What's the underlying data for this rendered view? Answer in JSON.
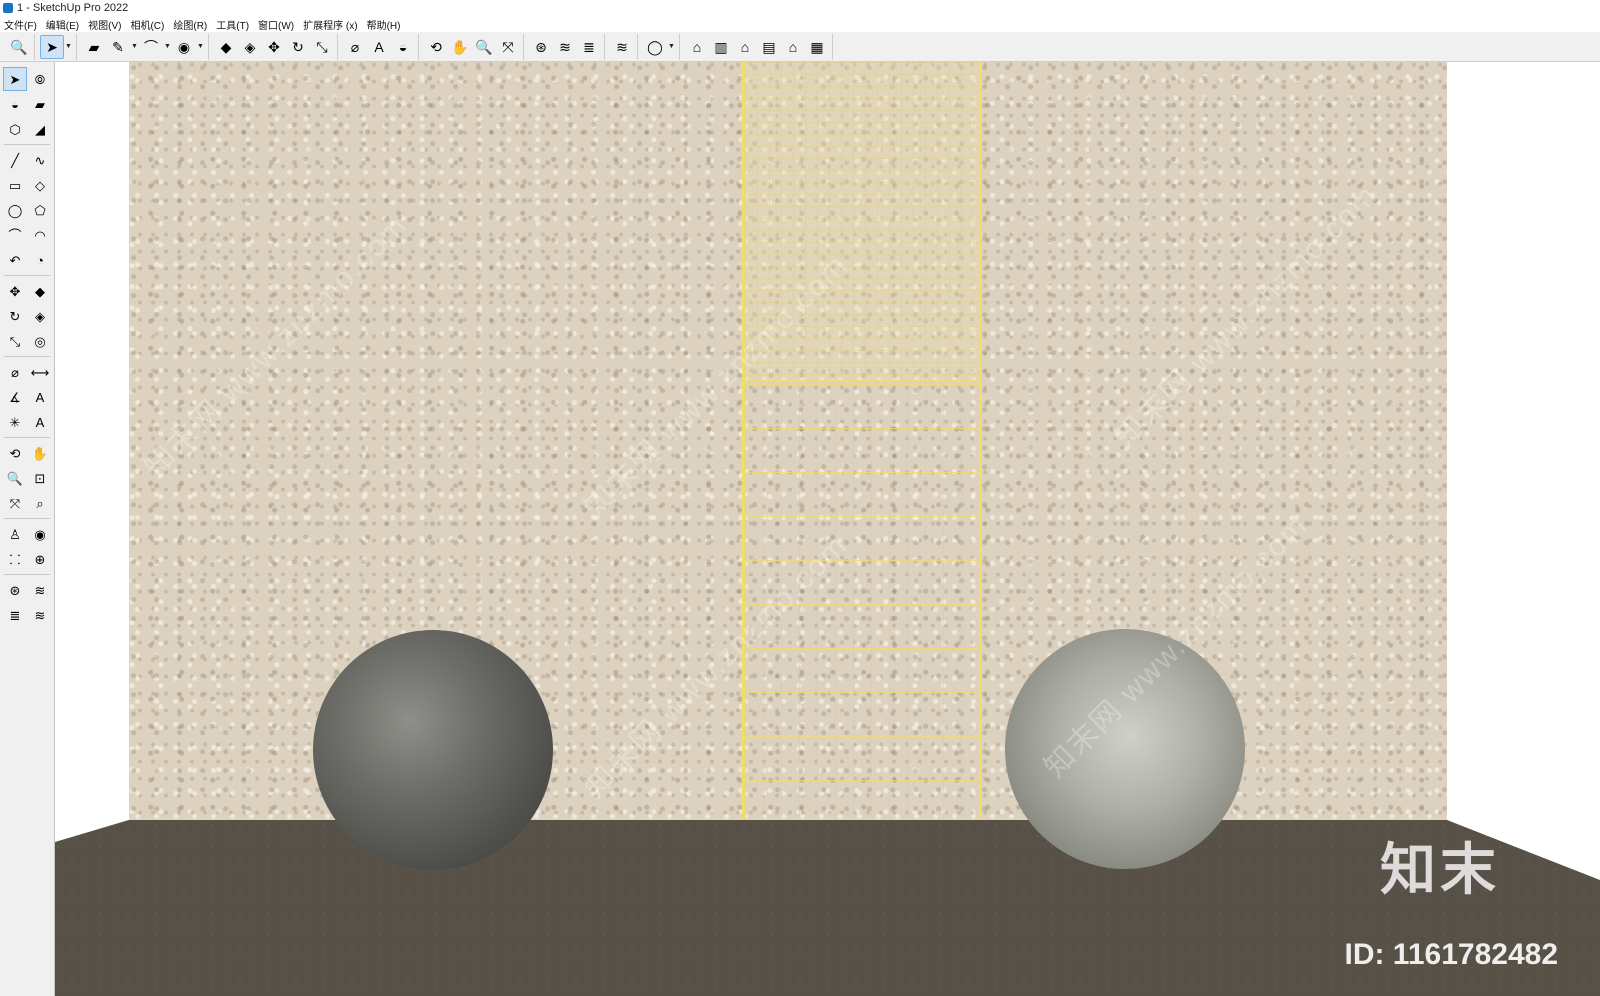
{
  "window": {
    "title": "1 - SketchUp Pro 2022"
  },
  "menu": [
    "文件(F)",
    "编辑(E)",
    "视图(V)",
    "相机(C)",
    "绘图(R)",
    "工具(T)",
    "窗口(W)",
    "扩展程序 (x)",
    "帮助(H)"
  ],
  "toolbar": {
    "groups": [
      [
        {
          "icon": "search-icon",
          "glyph": "🔍"
        }
      ],
      [
        {
          "icon": "select-icon",
          "glyph": "➤",
          "active": true,
          "drop": true
        }
      ],
      [
        {
          "icon": "eraser-icon",
          "glyph": "▰"
        },
        {
          "icon": "pencil-icon",
          "glyph": "✎",
          "drop": true
        },
        {
          "icon": "arc-icon",
          "glyph": "⌒",
          "drop": true
        },
        {
          "icon": "circle-icon",
          "glyph": "◉",
          "drop": true
        }
      ],
      [
        {
          "icon": "push-pull-icon",
          "glyph": "◆"
        },
        {
          "icon": "follow-me-icon",
          "glyph": "◈"
        },
        {
          "icon": "move-icon",
          "glyph": "✥"
        },
        {
          "icon": "rotate-icon",
          "glyph": "↻"
        },
        {
          "icon": "scale-icon",
          "glyph": "⤡"
        }
      ],
      [
        {
          "icon": "tape-measure-icon",
          "glyph": "⌀"
        },
        {
          "icon": "text-icon",
          "glyph": "A"
        },
        {
          "icon": "paint-bucket-icon",
          "glyph": "◒"
        }
      ],
      [
        {
          "icon": "orbit-icon",
          "glyph": "⟲"
        },
        {
          "icon": "pan-icon",
          "glyph": "✋"
        },
        {
          "icon": "zoom-icon",
          "glyph": "🔍"
        },
        {
          "icon": "zoom-extents-icon",
          "glyph": "⤧"
        }
      ],
      [
        {
          "icon": "warehouse-icon",
          "glyph": "⊛"
        },
        {
          "icon": "extension-warehouse-icon",
          "glyph": "≋"
        },
        {
          "icon": "layers-icon",
          "glyph": "≣"
        }
      ],
      [
        {
          "icon": "sandbox-icon",
          "glyph": "≋"
        }
      ],
      [
        {
          "icon": "account-icon",
          "glyph": "◯",
          "drop": true
        }
      ],
      [
        {
          "icon": "iso-view-icon",
          "glyph": "⌂"
        },
        {
          "icon": "top-view-icon",
          "glyph": "▥"
        },
        {
          "icon": "front-view-icon",
          "glyph": "⌂"
        },
        {
          "icon": "right-view-icon",
          "glyph": "▤"
        },
        {
          "icon": "back-view-icon",
          "glyph": "⌂"
        },
        {
          "icon": "left-view-icon",
          "glyph": "▦"
        }
      ]
    ]
  },
  "left_toolbar": [
    [
      {
        "icon": "select-icon",
        "glyph": "➤",
        "active": true
      },
      {
        "icon": "lasso-icon",
        "glyph": "⦾"
      }
    ],
    [
      {
        "icon": "paint-bucket-icon",
        "glyph": "◒"
      },
      {
        "icon": "eraser-icon",
        "glyph": "▰"
      }
    ],
    [
      {
        "icon": "component-icon",
        "glyph": "⬡"
      },
      {
        "icon": "tag-icon",
        "glyph": "◢"
      }
    ],
    [
      {
        "icon": "pencil-icon",
        "glyph": "╱"
      },
      {
        "icon": "freehand-icon",
        "glyph": "∿"
      }
    ],
    [
      {
        "icon": "rectangle-icon",
        "glyph": "▭"
      },
      {
        "icon": "rotated-rect-icon",
        "glyph": "◇"
      }
    ],
    [
      {
        "icon": "circle-icon",
        "glyph": "◯"
      },
      {
        "icon": "polygon-icon",
        "glyph": "⬠"
      }
    ],
    [
      {
        "icon": "arc-icon",
        "glyph": "⌒"
      },
      {
        "icon": "two-point-arc-icon",
        "glyph": "◠"
      }
    ],
    [
      {
        "icon": "three-point-arc-icon",
        "glyph": "↶"
      },
      {
        "icon": "pie-icon",
        "glyph": "◔"
      }
    ],
    [
      {
        "icon": "move-icon",
        "glyph": "✥"
      },
      {
        "icon": "push-pull-icon",
        "glyph": "◆"
      }
    ],
    [
      {
        "icon": "rotate-icon",
        "glyph": "↻"
      },
      {
        "icon": "follow-me-icon",
        "glyph": "◈"
      }
    ],
    [
      {
        "icon": "scale-icon",
        "glyph": "⤡"
      },
      {
        "icon": "offset-icon",
        "glyph": "◎"
      }
    ],
    [
      {
        "icon": "tape-measure-icon",
        "glyph": "⌀"
      },
      {
        "icon": "dimension-icon",
        "glyph": "⟷"
      }
    ],
    [
      {
        "icon": "protractor-icon",
        "glyph": "∡"
      },
      {
        "icon": "text-icon",
        "glyph": "A"
      }
    ],
    [
      {
        "icon": "axes-icon",
        "glyph": "✳"
      },
      {
        "icon": "3d-text-icon",
        "glyph": "A"
      }
    ],
    [
      {
        "icon": "orbit-icon",
        "glyph": "⟲"
      },
      {
        "icon": "pan-icon",
        "glyph": "✋"
      }
    ],
    [
      {
        "icon": "zoom-icon",
        "glyph": "🔍"
      },
      {
        "icon": "zoom-window-icon",
        "glyph": "⊡"
      }
    ],
    [
      {
        "icon": "zoom-extents-icon",
        "glyph": "⤧"
      },
      {
        "icon": "previous-view-icon",
        "glyph": "⌕"
      }
    ],
    [
      {
        "icon": "position-camera-icon",
        "glyph": "♙"
      },
      {
        "icon": "look-around-icon",
        "glyph": "◉"
      }
    ],
    [
      {
        "icon": "walk-icon",
        "glyph": "⸬"
      },
      {
        "icon": "section-plane-icon",
        "glyph": "⊕"
      }
    ],
    [
      {
        "icon": "warehouse-icon",
        "glyph": "⊛"
      },
      {
        "icon": "extension-warehouse-icon",
        "glyph": "≋"
      }
    ],
    [
      {
        "icon": "layers-icon",
        "glyph": "≣"
      },
      {
        "icon": "sandbox-icon",
        "glyph": "≋"
      }
    ]
  ],
  "viewport": {
    "watermark_text": "知末网 www.znzmo.com",
    "logo_text": "知末",
    "id_text": "ID: 1161782482"
  }
}
